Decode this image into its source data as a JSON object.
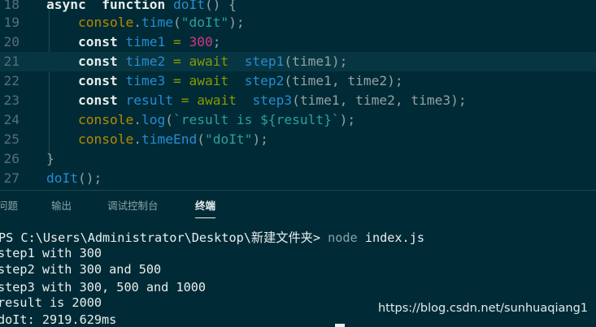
{
  "editor": {
    "lines": [
      {
        "num": "18",
        "tokens": [
          [
            "kw",
            "async"
          ],
          [
            "plain",
            "  "
          ],
          [
            "kw",
            "function"
          ],
          [
            "plain",
            " "
          ],
          [
            "fn",
            "doIt"
          ],
          [
            "plain",
            "() {"
          ]
        ]
      },
      {
        "num": "19",
        "tokens": [
          [
            "plain",
            "    "
          ],
          [
            "con",
            "console"
          ],
          [
            "plain",
            "."
          ],
          [
            "fn",
            "time"
          ],
          [
            "plain",
            "("
          ],
          [
            "str",
            "\"doIt\""
          ],
          [
            "plain",
            ");"
          ]
        ]
      },
      {
        "num": "20",
        "tokens": [
          [
            "plain",
            "    "
          ],
          [
            "kw",
            "const"
          ],
          [
            "plain",
            " "
          ],
          [
            "var",
            "time1"
          ],
          [
            "plain",
            " "
          ],
          [
            "op",
            "="
          ],
          [
            "plain",
            " "
          ],
          [
            "num",
            "300"
          ],
          [
            "plain",
            ";"
          ]
        ]
      },
      {
        "num": "21",
        "tokens": [
          [
            "plain",
            "    "
          ],
          [
            "kw",
            "const"
          ],
          [
            "plain",
            " "
          ],
          [
            "var",
            "time2"
          ],
          [
            "plain",
            " "
          ],
          [
            "op",
            "="
          ],
          [
            "plain",
            " "
          ],
          [
            "op",
            "await"
          ],
          [
            "plain",
            "  "
          ],
          [
            "fn",
            "step1"
          ],
          [
            "plain",
            "(time1);"
          ]
        ]
      },
      {
        "num": "22",
        "tokens": [
          [
            "plain",
            "    "
          ],
          [
            "kw",
            "const"
          ],
          [
            "plain",
            " "
          ],
          [
            "var",
            "time3"
          ],
          [
            "plain",
            " "
          ],
          [
            "op",
            "="
          ],
          [
            "plain",
            " "
          ],
          [
            "op",
            "await"
          ],
          [
            "plain",
            "  "
          ],
          [
            "fn",
            "step2"
          ],
          [
            "plain",
            "(time1, time2);"
          ]
        ]
      },
      {
        "num": "23",
        "tokens": [
          [
            "plain",
            "    "
          ],
          [
            "kw",
            "const"
          ],
          [
            "plain",
            " "
          ],
          [
            "var",
            "result"
          ],
          [
            "plain",
            " "
          ],
          [
            "op",
            "="
          ],
          [
            "plain",
            " "
          ],
          [
            "op",
            "await"
          ],
          [
            "plain",
            "  "
          ],
          [
            "fn",
            "step3"
          ],
          [
            "plain",
            "(time1, time2, time3);"
          ]
        ]
      },
      {
        "num": "24",
        "tokens": [
          [
            "plain",
            "    "
          ],
          [
            "con",
            "console"
          ],
          [
            "plain",
            "."
          ],
          [
            "fn",
            "log"
          ],
          [
            "plain",
            "("
          ],
          [
            "str",
            "`result is ${result}`"
          ],
          [
            "plain",
            ");"
          ]
        ]
      },
      {
        "num": "25",
        "tokens": [
          [
            "plain",
            "    "
          ],
          [
            "con",
            "console"
          ],
          [
            "plain",
            "."
          ],
          [
            "fn",
            "timeEnd"
          ],
          [
            "plain",
            "("
          ],
          [
            "str",
            "\"doIt\""
          ],
          [
            "plain",
            ");"
          ]
        ]
      },
      {
        "num": "26",
        "tokens": [
          [
            "plain",
            "}"
          ]
        ]
      },
      {
        "num": "27",
        "tokens": [
          [
            "fn",
            "doIt"
          ],
          [
            "plain",
            "();"
          ]
        ]
      }
    ],
    "current_line": "21"
  },
  "panel": {
    "tabs": [
      {
        "label": "问题"
      },
      {
        "label": "输出"
      },
      {
        "label": "调试控制台"
      },
      {
        "label": "终端",
        "active": true
      }
    ]
  },
  "terminal": {
    "prompt": "PS C:\\Users\\Administrator\\Desktop\\新建文件夹> ",
    "command_name": "node",
    "command_args": " index.js",
    "output": [
      "step1 with 300",
      "step2 with 300 and 500",
      "step3 with 300, 500 and 1000",
      "result is 2000",
      "doIt: 2919.629ms"
    ]
  },
  "watermark": "https://blog.csdn.net/sunhuaqiang1",
  "colors": {
    "background": "#002b36",
    "keyword": "#e7ecec",
    "function": "#268bd2",
    "string": "#2aa198",
    "number": "#d33682",
    "operator": "#859900",
    "console": "#b58900"
  }
}
